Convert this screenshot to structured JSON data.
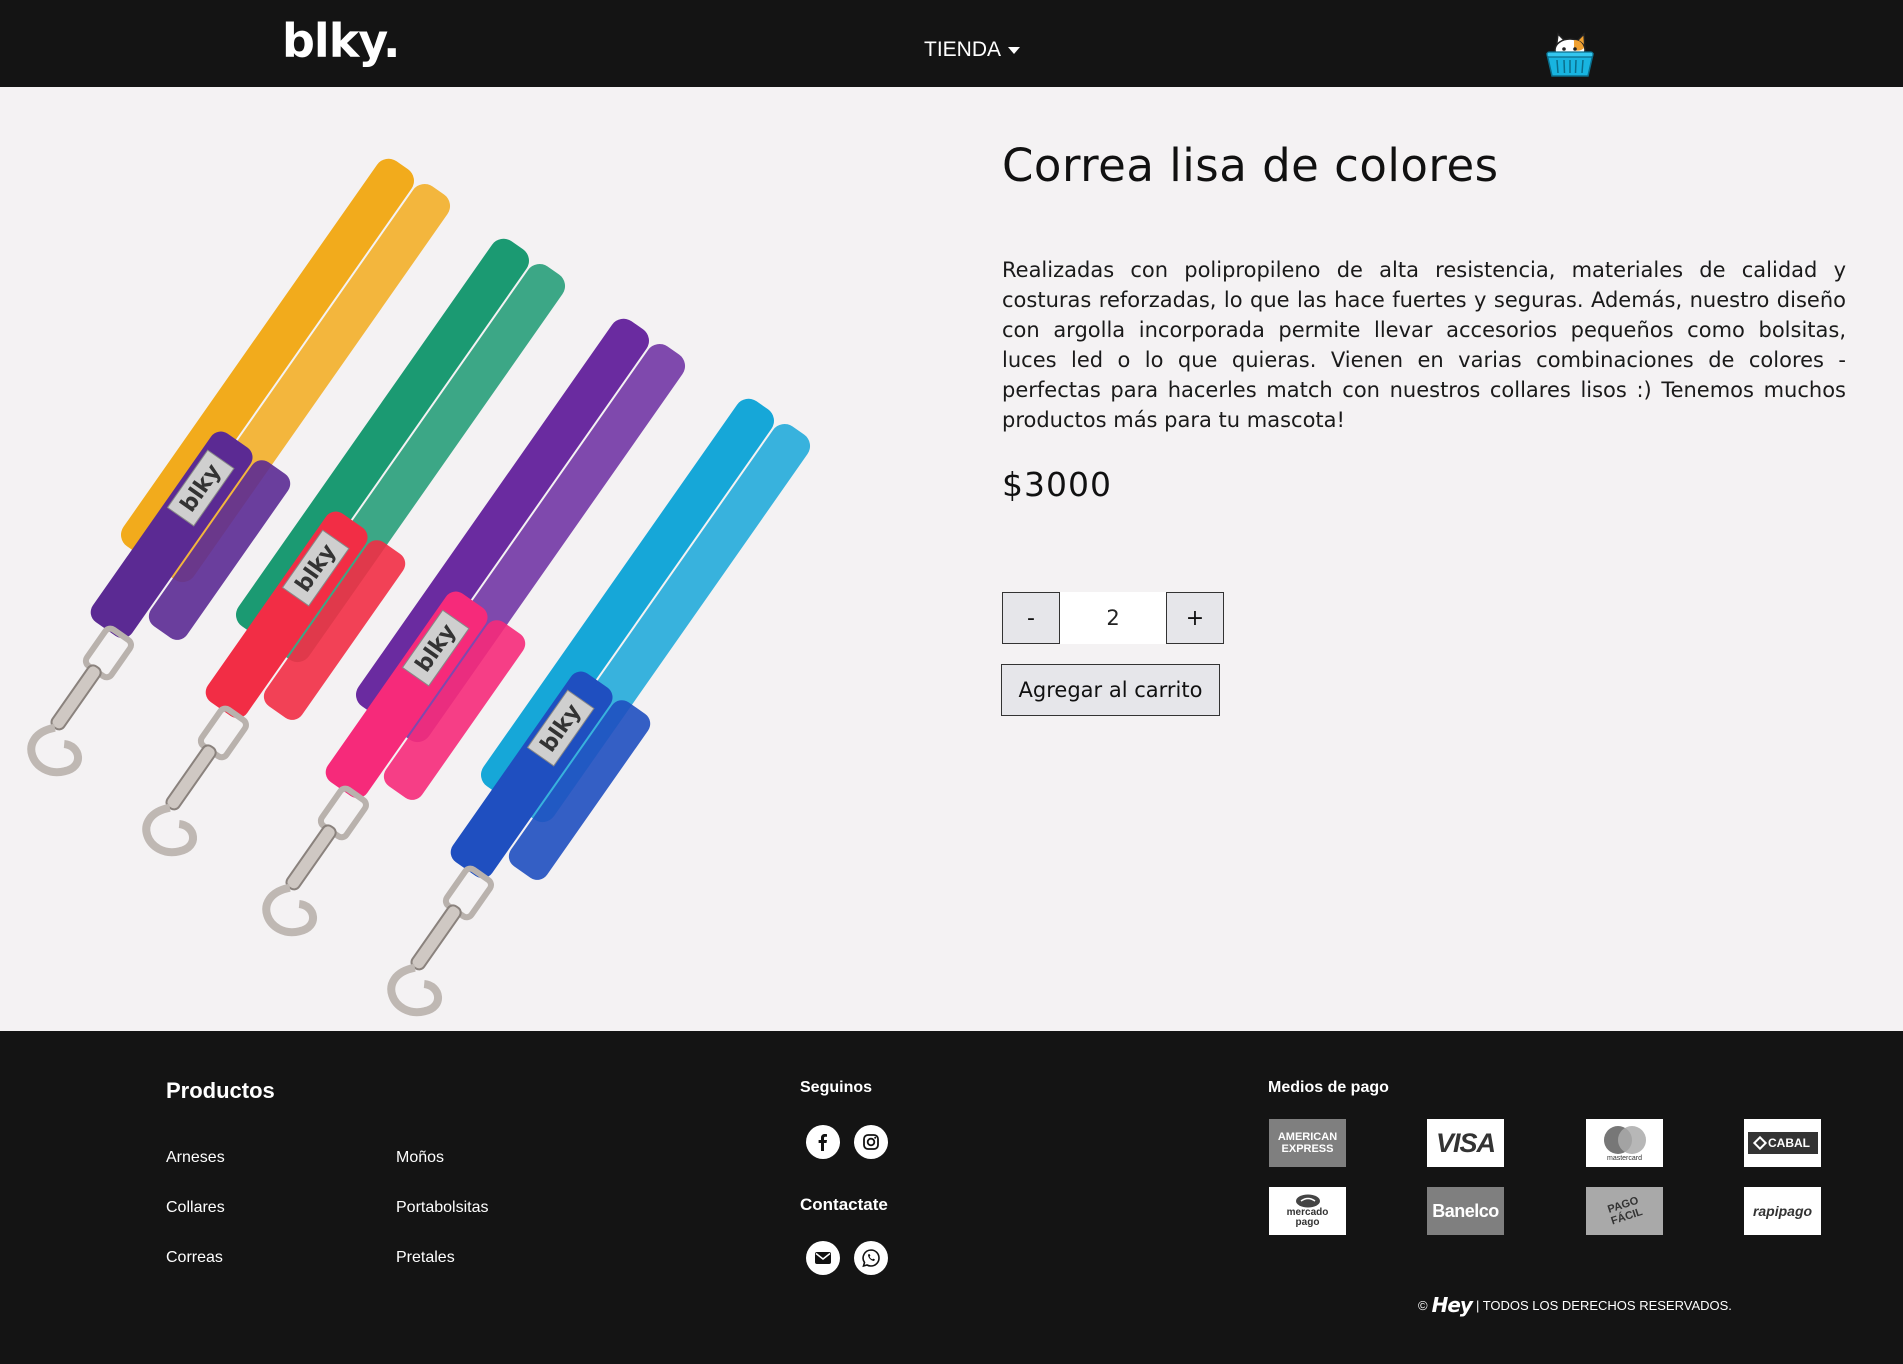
{
  "header": {
    "logo": "blky.",
    "nav_tienda": "TIENDA",
    "cart_icon": "cat-basket-icon"
  },
  "product": {
    "title": "Correa lisa de colores",
    "description": "Realizadas con polipropileno de alta resistencia, materiales de calidad y costuras reforzadas, lo que las hace fuertes y seguras. Además, nuestro diseño con argolla incorporada permite llevar accesorios pequeños como bolsitas, luces led o lo que quieras. Vienen en varias combinaciones de colores - perfectas para hacerles match con nuestros collares lisos :) Tenemos muchos productos más para tu mascota!",
    "price": "$3000",
    "quantity": "2",
    "minus_label": "-",
    "plus_label": "+",
    "add_to_cart": "Agregar al carrito",
    "leash_brand": "blky",
    "leash_colors": [
      "#f2ab1c",
      "#5b2a93",
      "#1b9a72",
      "#f22d45",
      "#6a2ba0",
      "#f62a7a",
      "#16a7d8",
      "#1f4fc0"
    ]
  },
  "footer": {
    "products_title": "Productos",
    "product_links": [
      "Arneses",
      "Moños",
      "Collares",
      "Portabolsitas",
      "Correas",
      "Pretales"
    ],
    "follow_title": "Seguinos",
    "contact_title": "Contactate",
    "social_icons": [
      "facebook-icon",
      "instagram-icon",
      "email-icon",
      "whatsapp-icon"
    ],
    "payments_title": "Medios de pago",
    "payments": [
      {
        "name": "AMERICAN EXPRESS",
        "bg": "#7f7f7f"
      },
      {
        "name": "VISA",
        "bg": "#ffffff"
      },
      {
        "name": "mastercard",
        "bg": "#ffffff"
      },
      {
        "name": "CABAL",
        "bg": "#ffffff"
      },
      {
        "name": "mercado pago",
        "bg": "#ffffff"
      },
      {
        "name": "Banelco",
        "bg": "#7f7f7f"
      },
      {
        "name": "PAGO FÁCIL",
        "bg": "#a9a9a9"
      },
      {
        "name": "rapipago",
        "bg": "#ffffff"
      }
    ],
    "copyright_symbol": "©",
    "copyright_brand": "Hey",
    "copyright_text": "| TODOS LOS DERECHOS RESERVADOS."
  }
}
